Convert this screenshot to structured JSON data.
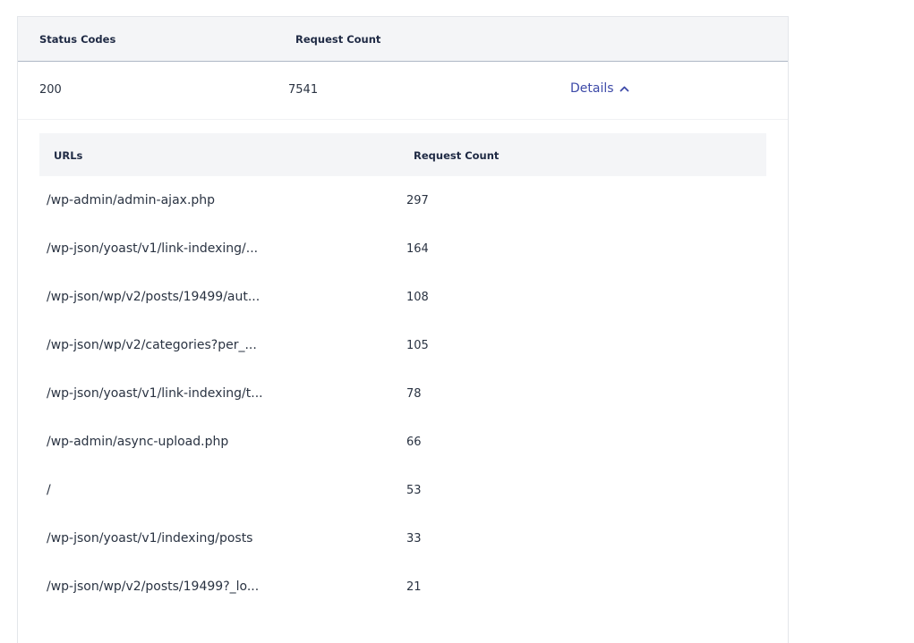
{
  "outer_table": {
    "headers": {
      "status": "Status Codes",
      "count": "Request Count"
    },
    "row": {
      "status": "200",
      "count": "7541",
      "details_label": "Details",
      "details_icon": "chevron-up-icon"
    }
  },
  "inner_table": {
    "headers": {
      "url": "URLs",
      "count": "Request Count"
    },
    "rows": [
      {
        "url": "/wp-admin/admin-ajax.php",
        "count": "297"
      },
      {
        "url": "/wp-json/yoast/v1/link-indexing/...",
        "count": "164"
      },
      {
        "url": "/wp-json/wp/v2/posts/19499/aut...",
        "count": "108"
      },
      {
        "url": "/wp-json/wp/v2/categories?per_...",
        "count": "105"
      },
      {
        "url": "/wp-json/yoast/v1/link-indexing/t...",
        "count": "78"
      },
      {
        "url": "/wp-admin/async-upload.php",
        "count": "66"
      },
      {
        "url": "/",
        "count": "53"
      },
      {
        "url": "/wp-json/yoast/v1/indexing/posts",
        "count": "33"
      },
      {
        "url": "/wp-json/wp/v2/posts/19499?_lo...",
        "count": "21"
      }
    ]
  },
  "colors": {
    "accent": "#3d4aa8",
    "header_bg": "#f4f5f7",
    "text": "#2a3342"
  }
}
